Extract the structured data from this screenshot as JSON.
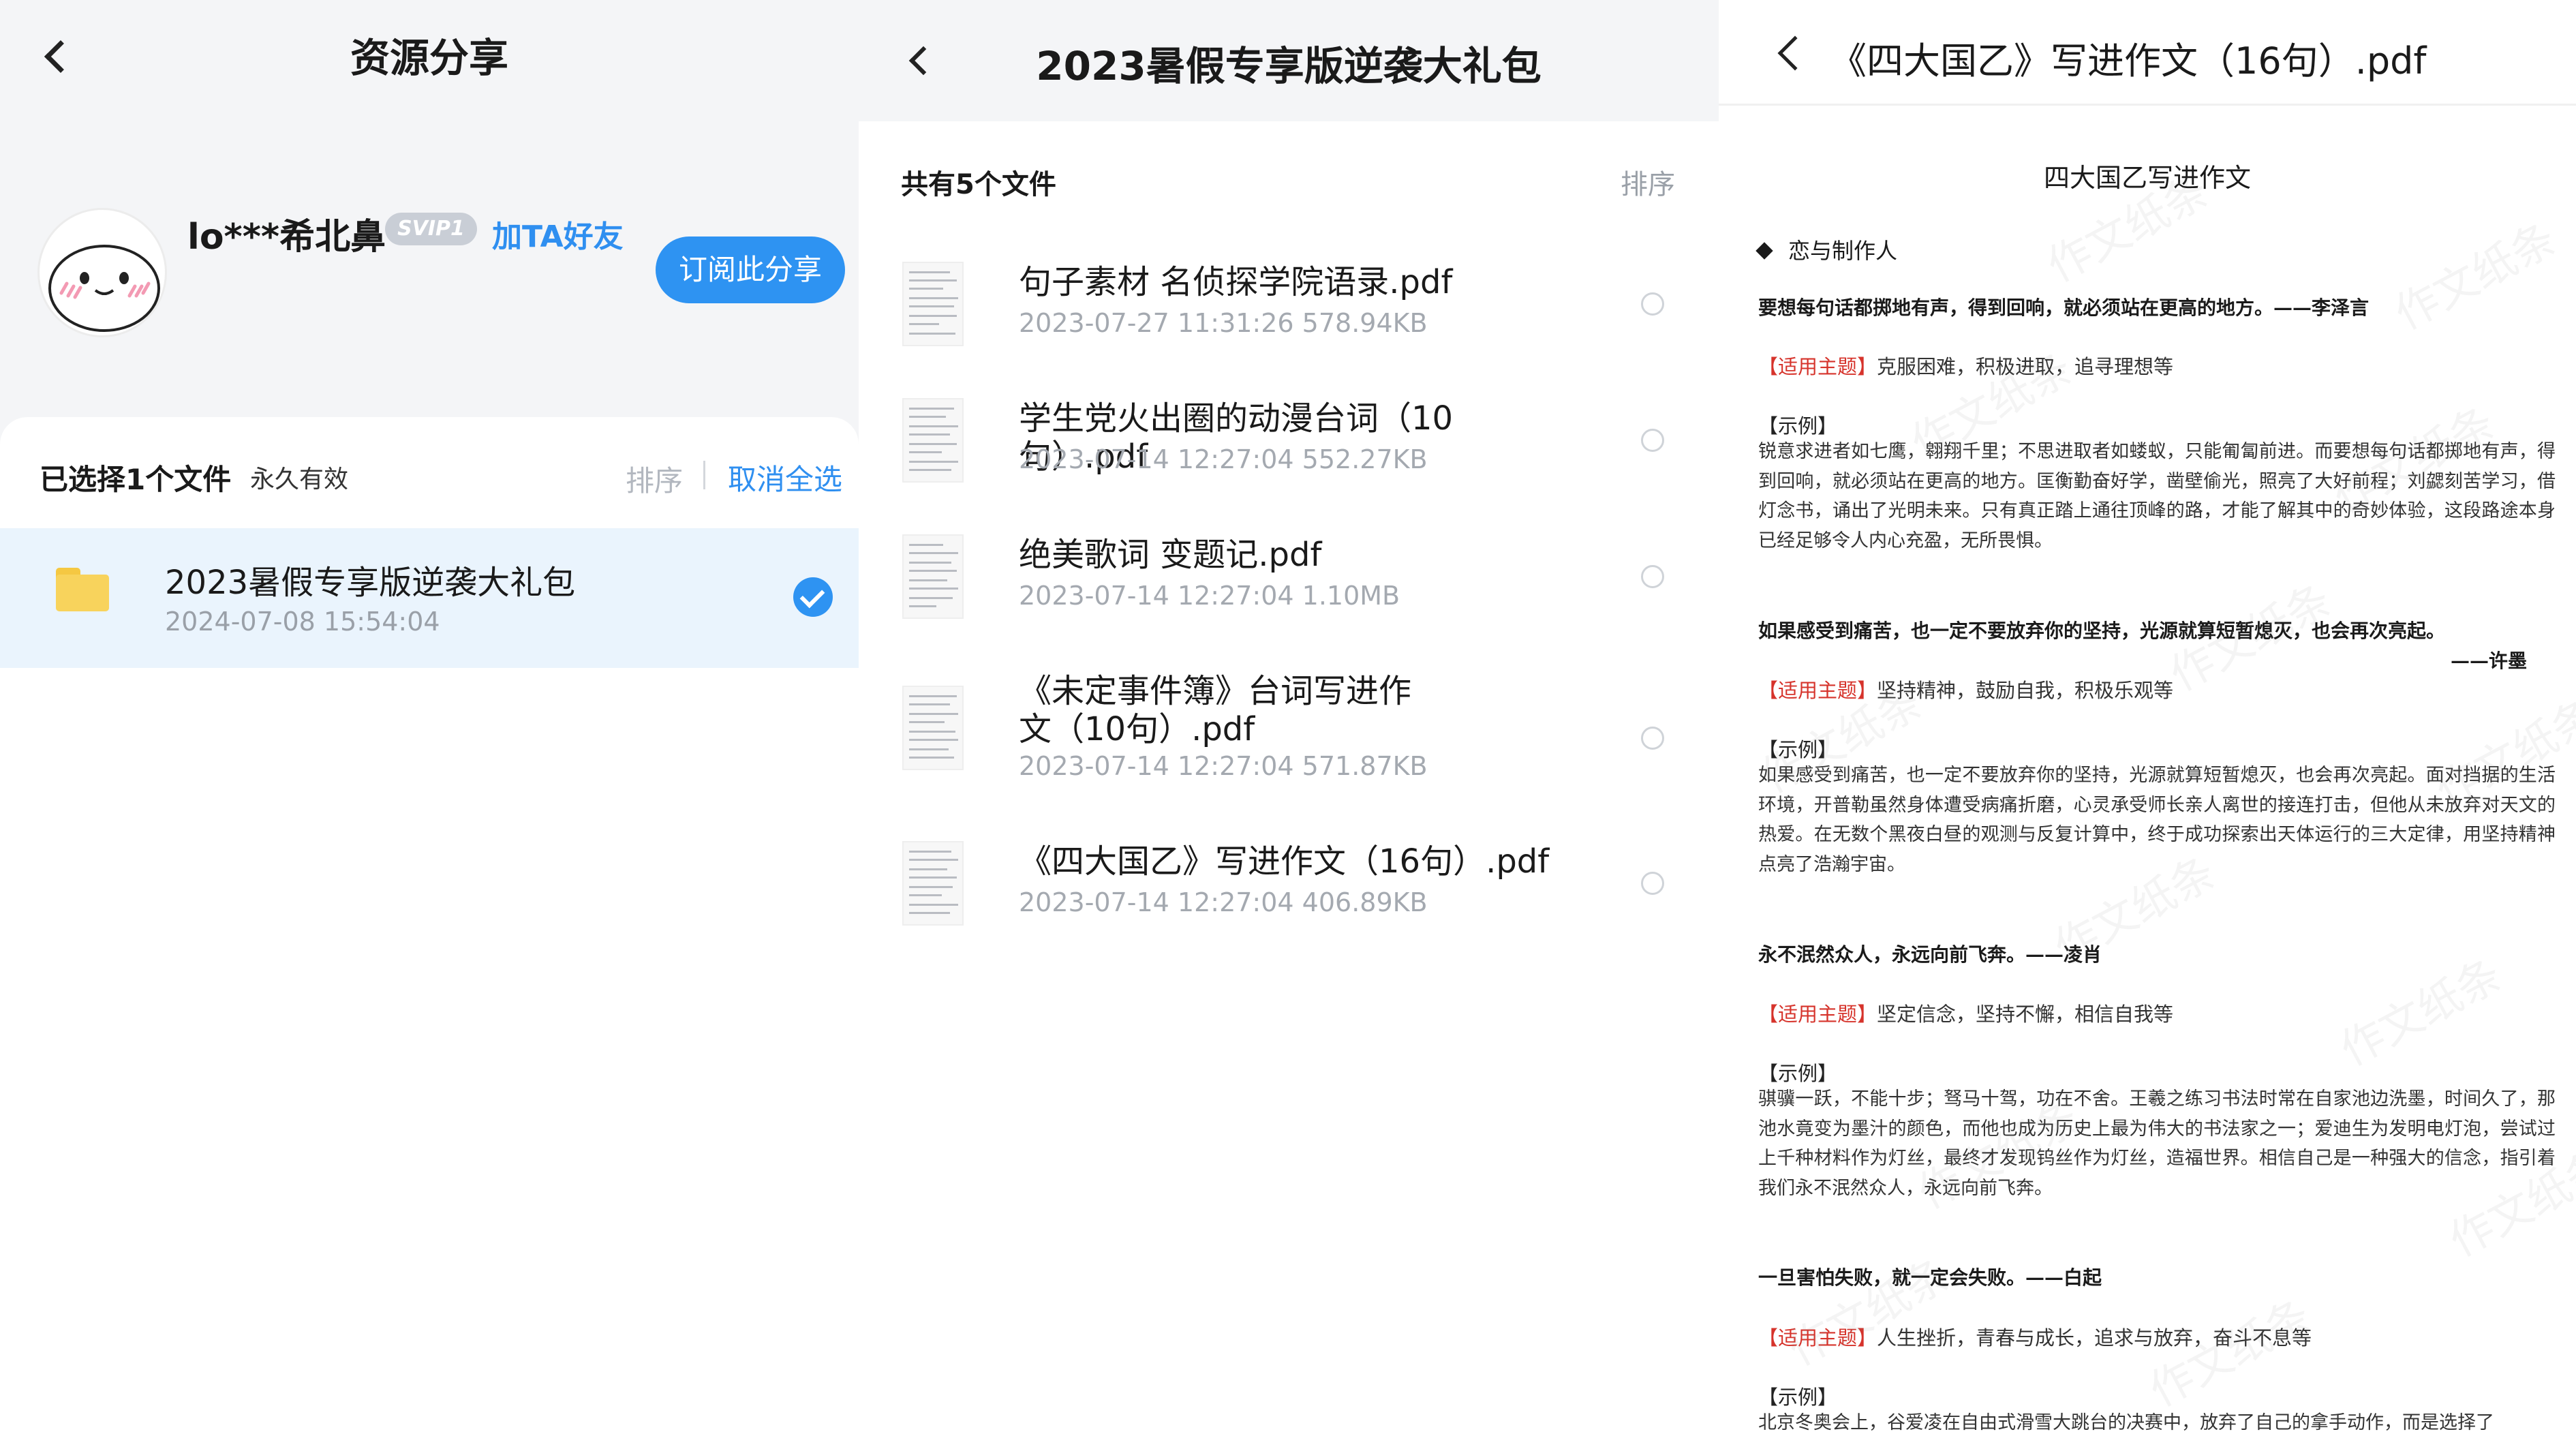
{
  "share_page": {
    "title": "资源分享",
    "user": {
      "name": "lo***希北鼻",
      "badge": "SVIP1",
      "add_friend": "加TA好友"
    },
    "subscribe_button": "订阅此分享",
    "selection": {
      "count_label": "已选择1个文件",
      "validity": "永久有效",
      "sort": "排序",
      "cancel_all": "取消全选"
    },
    "selected_item": {
      "name": "2023暑假专享版逆袭大礼包",
      "date": "2024-07-08  15:54:04"
    }
  },
  "folder_page": {
    "title": "2023暑假专享版逆袭大礼包",
    "file_count": "共有5个文件",
    "sort": "排序",
    "files": [
      {
        "name": "句子素材 名侦探学院语录.pdf",
        "meta": "2023-07-27  11:31:26  578.94KB"
      },
      {
        "name": "学生党火出圈的动漫台词（10句）.pdf",
        "meta": "2023-07-14  12:27:04  552.27KB"
      },
      {
        "name": "绝美歌词 变题记.pdf",
        "meta": "2023-07-14  12:27:04  1.10MB"
      },
      {
        "name": "《未定事件簿》台词写进作文（10句）.pdf",
        "meta": "2023-07-14  12:27:04  571.87KB"
      },
      {
        "name": "《四大国乙》写进作文（16句）.pdf",
        "meta": "2023-07-14  12:27:04  406.89KB"
      }
    ]
  },
  "preview_page": {
    "title": "《四大国乙》写进作文（16句）.pdf",
    "doc": {
      "title": "四大国乙写进作文",
      "section": "恋与制作人",
      "entries": [
        {
          "quote": "要想每句话都掷地有声，得到回响，就必须站在更高的地方。——李泽言",
          "theme_tag": "【适用主题】",
          "theme": "克服困难，积极进取，追寻理想等",
          "example_label": "【示例】",
          "example": "锐意求进者如七鹰，翱翔千里；不思进取者如蝼蚁，只能匍匐前进。而要想每句话都掷地有声，得到回响，就必须站在更高的地方。匡衡勤奋好学，凿壁偷光，照亮了大好前程；刘勰刻苦学习，借灯念书，诵出了光明未来。只有真正踏上通往顶峰的路，才能了解其中的奇妙体验，这段路途本身已经足够令人内心充盈，无所畏惧。"
        },
        {
          "quote": "如果感受到痛苦，也一定不要放弃你的坚持，光源就算短暂熄灭，也会再次亮起。",
          "signature": "——许墨",
          "theme_tag": "【适用主题】",
          "theme": "坚持精神，鼓励自我，积极乐观等",
          "example_label": "【示例】",
          "example": "如果感受到痛苦，也一定不要放弃你的坚持，光源就算短暂熄灭，也会再次亮起。面对挡据的生活环境，开普勒虽然身体遭受病痛折磨，心灵承受师长亲人离世的接连打击，但他从未放弃对天文的热爱。在无数个黑夜白昼的观测与反复计算中，终于成功探索出天体运行的三大定律，用坚持精神点亮了浩瀚宇宙。"
        },
        {
          "quote": "永不泯然众人，永远向前飞奔。——凌肖",
          "theme_tag": "【适用主题】",
          "theme": "坚定信念，坚持不懈，相信自我等",
          "example_label": "【示例】",
          "example": "骐骥一跃，不能十步；驽马十驾，功在不舍。王羲之练习书法时常在自家池边洗墨，时间久了，那池水竟变为墨汁的颜色，而他也成为历史上最为伟大的书法家之一；爱迪生为发明电灯泡，尝试过上千种材料作为灯丝，最终才发现钨丝作为灯丝，造福世界。相信自己是一种强大的信念，指引着我们永不泯然众人，永远向前飞奔。"
        },
        {
          "quote": "一旦害怕失败，就一定会失败。——白起",
          "theme_tag": "【适用主题】",
          "theme": "人生挫折，青春与成长，追求与放弃，奋斗不息等",
          "example_label": "【示例】",
          "example": "北京冬奥会上，谷爱凌在自由式滑雪大跳台的决赛中，放弃了自己的拿手动作，而是选择了"
        }
      ]
    },
    "watermark": "作文纸条"
  }
}
